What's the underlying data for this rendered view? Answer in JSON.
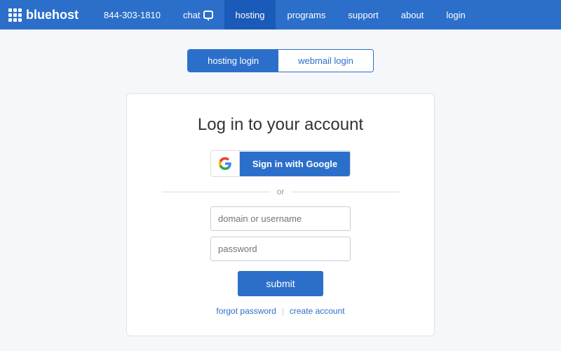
{
  "nav": {
    "logo_text": "bluehost",
    "phone": "844-303-1810",
    "items": [
      {
        "label": "chat",
        "id": "chat",
        "has_bubble": true
      },
      {
        "label": "hosting",
        "id": "hosting",
        "active": true
      },
      {
        "label": "programs",
        "id": "programs"
      },
      {
        "label": "support",
        "id": "support"
      },
      {
        "label": "about",
        "id": "about"
      },
      {
        "label": "login",
        "id": "login"
      }
    ]
  },
  "tabs": [
    {
      "label": "hosting login",
      "id": "hosting-login",
      "active": true
    },
    {
      "label": "webmail login",
      "id": "webmail-login"
    }
  ],
  "form": {
    "title": "Log in to your account",
    "google_btn_label": "Sign in with Google",
    "or_text": "or",
    "username_placeholder": "domain or username",
    "password_placeholder": "password",
    "submit_label": "submit",
    "forgot_password_label": "forgot password",
    "create_account_label": "create account"
  }
}
